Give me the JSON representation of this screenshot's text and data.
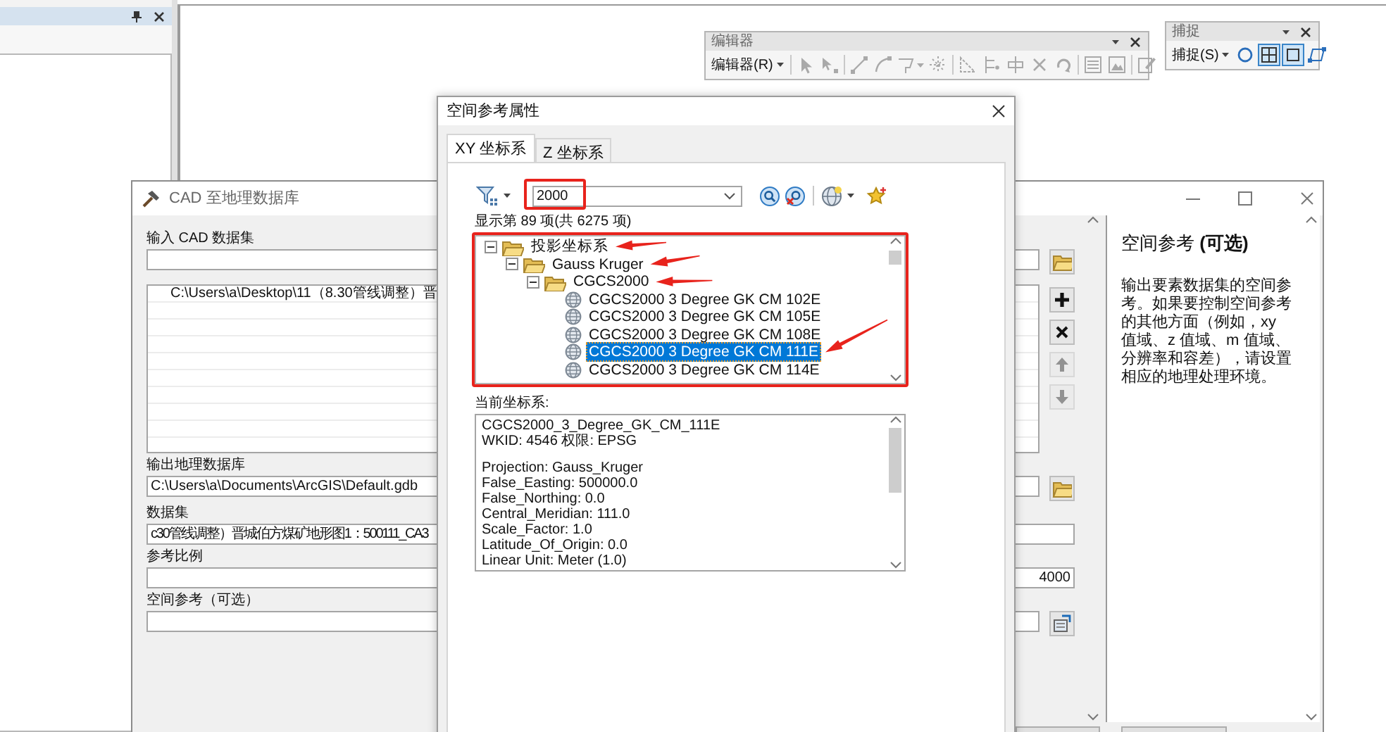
{
  "editor_toolbar": {
    "title": "编辑器",
    "menu": "编辑器(R)",
    "tools": [
      {
        "kind": "select",
        "disabled": true
      },
      {
        "kind": "vertex",
        "disabled": true
      },
      {
        "kind": "line",
        "disabled": true
      },
      {
        "kind": "arc",
        "disabled": true
      },
      {
        "kind": "polygon",
        "disabled": true
      },
      {
        "kind": "midpoint",
        "disabled": true
      },
      {
        "kind": "trace",
        "disabled": true
      },
      {
        "kind": "split",
        "disabled": true
      },
      {
        "kind": "cut",
        "disabled": true
      },
      {
        "kind": "delete",
        "disabled": true
      },
      {
        "kind": "rotate",
        "disabled": true
      },
      {
        "kind": "attributes",
        "disabled": true
      },
      {
        "kind": "sketch",
        "disabled": true
      },
      {
        "kind": "properties",
        "disabled": true
      }
    ]
  },
  "snap_toolbar": {
    "title": "捕捉",
    "menu": "捕捉(S)",
    "tools": [
      {
        "kind": "point",
        "selected": false
      },
      {
        "kind": "vertex",
        "selected": true
      },
      {
        "kind": "edge",
        "selected": true
      },
      {
        "kind": "end",
        "selected": false
      }
    ]
  },
  "cad_dialog": {
    "title": "CAD 至地理数据库",
    "input_label": "输入 CAD 数据集",
    "input_files": [
      "C:\\Users\\a\\Desktop\\11（8.30管线调整）晋"
    ],
    "list_buttons": [
      {
        "kind": "add",
        "disabled": false
      },
      {
        "kind": "remove",
        "disabled": false
      },
      {
        "kind": "up",
        "disabled": true
      },
      {
        "kind": "down",
        "disabled": true
      }
    ],
    "output_label": "输出地理数据库",
    "output_value": "C:\\Users\\a\\Documents\\ArcGIS\\Default.gdb",
    "dataset_label": "数据集",
    "dataset_value": "c30管线调整）晋城伯方煤矿地形图1：500111_CA3",
    "scale_label": "参考比例",
    "scale_value": "4000",
    "sr_label": "空间参考（可选）",
    "help": {
      "title": "空间参考 **(可选)**",
      "body": "输出要素数据集的空间参考。如果要控制空间参考的其他方面（例如，xy 值域、z 值域、m 值域、分辨率和容差），请设置相应的地理处理环境。"
    }
  },
  "spatial_reference_dialog": {
    "title": "空间参考属性",
    "tabs": [
      {
        "label": "XY 坐标系",
        "selected": true
      },
      {
        "label": "Z 坐标系",
        "selected": false
      }
    ],
    "search": {
      "value": "2000"
    },
    "result_count": "显示第 89 项(共 6275 项)",
    "tree": [
      {
        "label": "投影坐标系",
        "kind": "folder",
        "expanded": true,
        "children": [
          {
            "label": "Gauss Kruger",
            "kind": "folder",
            "expanded": true,
            "children": [
              {
                "label": "CGCS2000",
                "kind": "folder",
                "expanded": true,
                "children": [
                  {
                    "label": "CGCS2000 3 Degree GK CM 102E",
                    "kind": "crs",
                    "selected": false
                  },
                  {
                    "label": "CGCS2000 3 Degree GK CM 105E",
                    "kind": "crs",
                    "selected": false
                  },
                  {
                    "label": "CGCS2000 3 Degree GK CM 108E",
                    "kind": "crs",
                    "selected": false
                  },
                  {
                    "label": "CGCS2000 3 Degree GK CM 111E",
                    "kind": "crs",
                    "selected": true
                  },
                  {
                    "label": "CGCS2000 3 Degree GK CM 114E",
                    "kind": "crs",
                    "selected": false
                  }
                ]
              }
            ]
          }
        ]
      }
    ],
    "current_label": "当前坐标系:",
    "current_header": [
      "CGCS2000_3_Degree_GK_CM_111E",
      "WKID: 4546 权限: EPSG"
    ],
    "current_parameters": [
      "Projection: Gauss_Kruger",
      "False_Easting: 500000.0",
      "False_Northing: 0.0",
      "Central_Meridian: 111.0",
      "Scale_Factor: 1.0",
      "Latitude_Of_Origin: 0.0",
      "Linear Unit: Meter (1.0)"
    ]
  }
}
